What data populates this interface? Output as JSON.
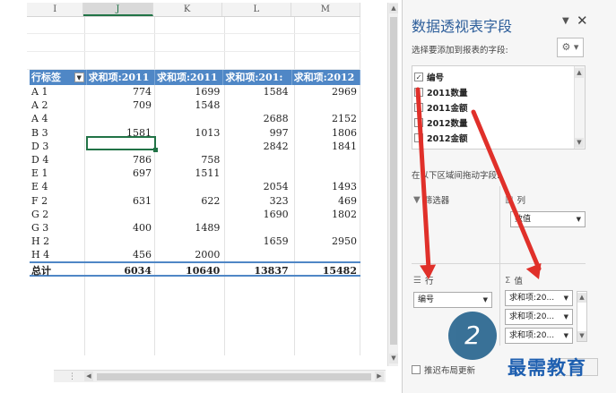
{
  "sheet": {
    "columns": [
      "I",
      "J",
      "K",
      "L",
      "M"
    ],
    "selected_column": "J",
    "pivot": {
      "headers": [
        "行标签",
        "求和项:2011",
        "求和项:2011",
        "求和项:201:",
        "求和项:2012"
      ],
      "rows": [
        [
          "A 1",
          "774",
          "1699",
          "1584",
          "2969"
        ],
        [
          "A 2",
          "709",
          "1548",
          "",
          ""
        ],
        [
          "A 4",
          "",
          "",
          "2688",
          "2152"
        ],
        [
          "B 3",
          "1581",
          "1013",
          "997",
          "1806"
        ],
        [
          "D 3",
          "",
          "",
          "2842",
          "1841"
        ],
        [
          "D 4",
          "786",
          "758",
          "",
          ""
        ],
        [
          "E 1",
          "697",
          "1511",
          "",
          ""
        ],
        [
          "E 4",
          "",
          "",
          "2054",
          "1493"
        ],
        [
          "F 2",
          "631",
          "622",
          "323",
          "469"
        ],
        [
          "G 2",
          "",
          "",
          "1690",
          "1802"
        ],
        [
          "G 3",
          "400",
          "1489",
          "",
          ""
        ],
        [
          "H 2",
          "",
          "",
          "1659",
          "2950"
        ],
        [
          "H 4",
          "456",
          "2000",
          "",
          ""
        ]
      ],
      "total": [
        "总计",
        "6034",
        "10640",
        "13837",
        "15482"
      ]
    }
  },
  "panel": {
    "title": "数据透视表字段",
    "subtitle": "选择要添加到报表的字段:",
    "fields": [
      {
        "label": "编号",
        "checked": true
      },
      {
        "label": "2011数量",
        "checked": false
      },
      {
        "label": "2011金额",
        "checked": false
      },
      {
        "label": "2012数量",
        "checked": false
      },
      {
        "label": "2012金额",
        "checked": false
      }
    ],
    "drag_hint": "在以下区域间拖动字段:",
    "areas": {
      "filters": "筛选器",
      "columns": "列",
      "rows": "行",
      "values": "值"
    },
    "column_field": "数值",
    "row_field": "编号",
    "value_fields": [
      "求和项:20...",
      "求和项:20...",
      "求和项:20..."
    ],
    "defer_update": "推迟布局更新"
  },
  "overlay": {
    "step_number": "2",
    "watermark": "最需教育",
    "arrow_color": "#e0302a"
  }
}
